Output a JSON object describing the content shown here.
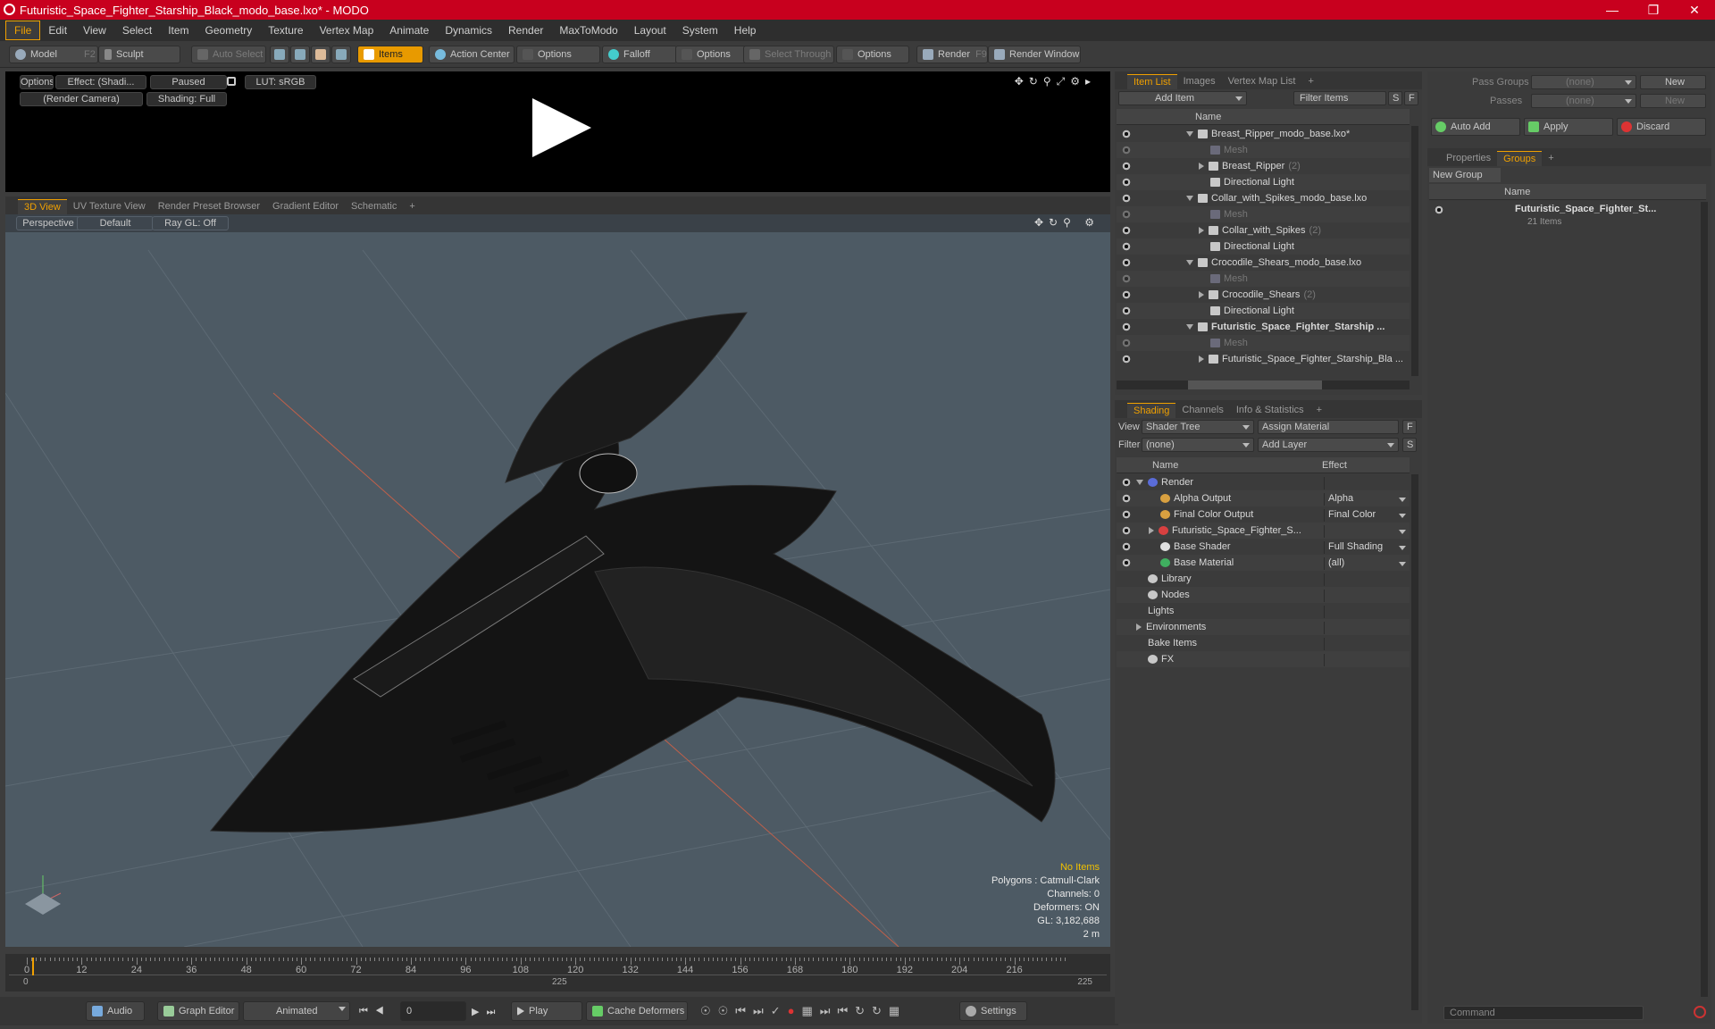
{
  "window": {
    "title": "Futuristic_Space_Fighter_Starship_Black_modo_base.lxo* - MODO"
  },
  "menu": [
    "File",
    "Edit",
    "View",
    "Select",
    "Item",
    "Geometry",
    "Texture",
    "Vertex Map",
    "Animate",
    "Dynamics",
    "Render",
    "MaxToModo",
    "Layout",
    "System",
    "Help"
  ],
  "toolbar": {
    "model": "Model",
    "model_key": "F2",
    "sculpt": "Sculpt",
    "auto_select": "Auto Select",
    "items": "Items",
    "action_center": "Action Center",
    "options1": "Options",
    "falloff": "Falloff",
    "options2": "Options",
    "select_through": "Select Through",
    "options3": "Options",
    "render": "Render",
    "render_key": "F9",
    "render_window": "Render Window"
  },
  "preview": {
    "options": "Options",
    "effect": "Effect: (Shadi...",
    "paused": "Paused",
    "lut": "LUT: sRGB",
    "camera": "(Render Camera)",
    "shading": "Shading: Full"
  },
  "view_tabs": [
    "3D View",
    "UV Texture View",
    "Render Preset Browser",
    "Gradient Editor",
    "Schematic"
  ],
  "viewport": {
    "perspective": "Perspective",
    "default": "Default",
    "raygl": "Ray GL: Off",
    "info": {
      "no_items": "No Items",
      "polygons": "Polygons : Catmull-Clark",
      "channels": "Channels: 0",
      "deformers": "Deformers: ON",
      "gl": "GL: 3,182,688",
      "scale": "2 m"
    }
  },
  "timeline": {
    "ticks": [
      "0",
      "12",
      "24",
      "36",
      "48",
      "60",
      "72",
      "84",
      "96",
      "108",
      "120",
      "132",
      "144",
      "156",
      "168",
      "180",
      "192",
      "204",
      "216"
    ],
    "start": "0",
    "mid": "225",
    "end": "225"
  },
  "bottom": {
    "audio": "Audio",
    "graph_editor": "Graph Editor",
    "animated": "Animated",
    "frame": "0",
    "play": "Play",
    "cache": "Cache Deformers",
    "settings": "Settings"
  },
  "item_list": {
    "tabs": [
      "Item List",
      "Images",
      "Vertex Map List"
    ],
    "add_item": "Add Item",
    "filter": "Filter Items",
    "s": "S",
    "f": "F",
    "col_name": "Name",
    "rows": [
      {
        "label": "Breast_Ripper_modo_base.lxo*",
        "indent": 1,
        "kind": "scene",
        "count": ""
      },
      {
        "label": "Mesh",
        "indent": 2,
        "kind": "mesh",
        "count": ""
      },
      {
        "label": "Breast_Ripper",
        "indent": 2,
        "kind": "group",
        "count": "(2)"
      },
      {
        "label": "Directional Light",
        "indent": 2,
        "kind": "light",
        "count": ""
      },
      {
        "label": "Collar_with_Spikes_modo_base.lxo",
        "indent": 1,
        "kind": "scene",
        "count": ""
      },
      {
        "label": "Mesh",
        "indent": 2,
        "kind": "mesh",
        "count": ""
      },
      {
        "label": "Collar_with_Spikes",
        "indent": 2,
        "kind": "group",
        "count": "(2)"
      },
      {
        "label": "Directional Light",
        "indent": 2,
        "kind": "light",
        "count": ""
      },
      {
        "label": "Crocodile_Shears_modo_base.lxo",
        "indent": 1,
        "kind": "scene",
        "count": ""
      },
      {
        "label": "Mesh",
        "indent": 2,
        "kind": "mesh",
        "count": ""
      },
      {
        "label": "Crocodile_Shears",
        "indent": 2,
        "kind": "group",
        "count": "(2)"
      },
      {
        "label": "Directional Light",
        "indent": 2,
        "kind": "light",
        "count": ""
      },
      {
        "label": "Futuristic_Space_Fighter_Starship ...",
        "indent": 1,
        "kind": "scene-bold",
        "count": ""
      },
      {
        "label": "Mesh",
        "indent": 2,
        "kind": "mesh",
        "count": ""
      },
      {
        "label": "Futuristic_Space_Fighter_Starship_Bla ...",
        "indent": 2,
        "kind": "group",
        "count": ""
      }
    ]
  },
  "shading": {
    "tabs": [
      "Shading",
      "Channels",
      "Info & Statistics"
    ],
    "view_label": "View",
    "view_value": "Shader Tree",
    "assign": "Assign Material",
    "f": "F",
    "filter_label": "Filter",
    "filter_value": "(none)",
    "add_layer": "Add Layer",
    "s": "S",
    "col_name": "Name",
    "col_effect": "Effect",
    "rows": [
      {
        "label": "Render",
        "effect": "",
        "indent": 0,
        "icon": "#5a6cd8",
        "eye": true,
        "arrow": "down"
      },
      {
        "label": "Alpha Output",
        "effect": "Alpha",
        "indent": 1,
        "icon": "#d8a040",
        "eye": true,
        "arrow": ""
      },
      {
        "label": "Final Color Output",
        "effect": "Final Color",
        "indent": 1,
        "icon": "#d8a040",
        "eye": true,
        "arrow": ""
      },
      {
        "label": "Futuristic_Space_Fighter_S...",
        "effect": "",
        "indent": 1,
        "icon": "#d84040",
        "eye": true,
        "arrow": "right"
      },
      {
        "label": "Base Shader",
        "effect": "Full Shading",
        "indent": 1,
        "icon": "#e0e0e0",
        "eye": true,
        "arrow": ""
      },
      {
        "label": "Base Material",
        "effect": "(all)",
        "indent": 1,
        "icon": "#40b060",
        "eye": true,
        "arrow": ""
      },
      {
        "label": "Library",
        "effect": "",
        "indent": 0,
        "icon": "#c8c8c8",
        "eye": false,
        "arrow": ""
      },
      {
        "label": "Nodes",
        "effect": "",
        "indent": 0,
        "icon": "#c8c8c8",
        "eye": false,
        "arrow": ""
      },
      {
        "label": "Lights",
        "effect": "",
        "indent": 0,
        "icon": "",
        "eye": false,
        "arrow": ""
      },
      {
        "label": "Environments",
        "effect": "",
        "indent": 0,
        "icon": "",
        "eye": false,
        "arrow": "right"
      },
      {
        "label": "Bake Items",
        "effect": "",
        "indent": 0,
        "icon": "",
        "eye": false,
        "arrow": ""
      },
      {
        "label": "FX",
        "effect": "",
        "indent": 0,
        "icon": "#c8c8c8",
        "eye": false,
        "arrow": ""
      }
    ]
  },
  "groups_panel": {
    "pass_groups": "Pass Groups",
    "pass_groups_value": "(none)",
    "new": "New",
    "passes": "Passes",
    "passes_value": "(none)",
    "new2": "New",
    "auto_add": "Auto Add",
    "apply": "Apply",
    "discard": "Discard",
    "tabs": [
      "Properties",
      "Groups"
    ],
    "new_group": "New Group",
    "col_name": "Name",
    "group_name": "Futuristic_Space_Fighter_St...",
    "group_count": "21 Items",
    "command_placeholder": "Command"
  },
  "colors": {
    "title_bar": "#c8001e",
    "accent": "#f0a000",
    "viewport_bg": "#4d5a64"
  }
}
